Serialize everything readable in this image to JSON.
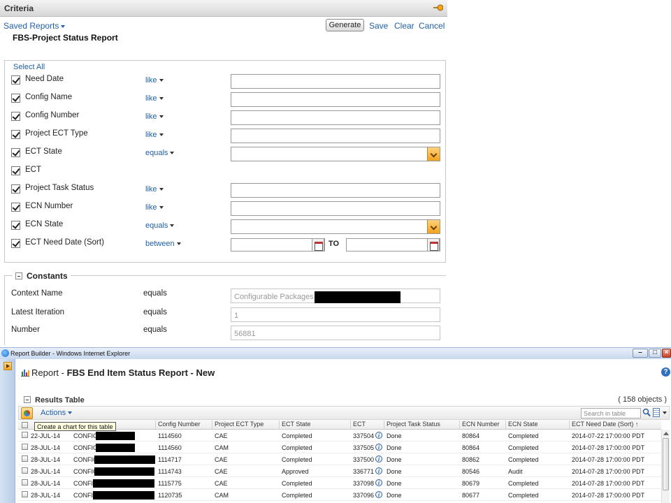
{
  "criteria_panel": {
    "header_title": "Criteria",
    "saved_reports": "Saved Reports",
    "buttons": {
      "generate": "Generate",
      "save": "Save",
      "clear": "Clear",
      "cancel": "Cancel"
    },
    "report_title": "FBS-Project Status Report",
    "select_all": "Select All",
    "rows": [
      {
        "label": "Need Date",
        "operator": "like"
      },
      {
        "label": "Config Name",
        "operator": "like"
      },
      {
        "label": "Config Number",
        "operator": "like"
      },
      {
        "label": "Project ECT Type",
        "operator": "like"
      },
      {
        "label": "ECT State",
        "operator": "equals"
      },
      {
        "label": "ECT",
        "operator": ""
      },
      {
        "label": "Project Task Status",
        "operator": "like"
      },
      {
        "label": "ECN Number",
        "operator": "like"
      },
      {
        "label": "ECN State",
        "operator": "equals"
      },
      {
        "label": "ECT Need Date (Sort)",
        "operator": "between"
      }
    ],
    "to_label": "TO"
  },
  "constants": {
    "title": "Constants",
    "rows": [
      {
        "label": "Context Name",
        "operator": "equals",
        "value": "Configurable Packages"
      },
      {
        "label": "Latest Iteration",
        "operator": "equals",
        "value": "1"
      },
      {
        "label": "Number",
        "operator": "equals",
        "value": "56881"
      }
    ]
  },
  "browser": {
    "window_title": "Report Builder - Windows Internet Explorer",
    "report_prefix": "Report - ",
    "report_name": "FBS End Item Status Report - New",
    "results_title": "Results Table",
    "results_count": "( 158 objects )",
    "actions_label": "Actions",
    "search_placeholder": "Search in table",
    "chart_tooltip": "Create a chart for this table",
    "columns": [
      "Config Number",
      "Project ECT Type",
      "ECT State",
      "ECT",
      "Project Task Status",
      "ECN Number",
      "ECN State",
      "ECT Need Date (Sort)"
    ],
    "sort_indicator": "↑",
    "rows": [
      {
        "need_date": "22-JUL-14",
        "config_name": "CONFIG,",
        "config_number": "1114560",
        "ect_type": "CAE",
        "ect_state": "Completed",
        "ect": "337504",
        "task_status": "Done",
        "ecn_number": "80864",
        "ecn_state": "Completed",
        "ect_need_date": "2014-07-22 17:00:00 PDT"
      },
      {
        "need_date": "28-JUL-14",
        "config_name": "CONFIG,",
        "config_number": "1114560",
        "ect_type": "CAM",
        "ect_state": "Completed",
        "ect": "337505",
        "task_status": "Done",
        "ecn_number": "80864",
        "ecn_state": "Completed",
        "ect_need_date": "2014-07-28 17:00:00 PDT"
      },
      {
        "need_date": "28-JUL-14",
        "config_name": "CONFIG,",
        "config_number": "1114717",
        "ect_type": "CAE",
        "ect_state": "Completed",
        "ect": "337500",
        "task_status": "Done",
        "ecn_number": "80862",
        "ecn_state": "Completed",
        "ect_need_date": "2014-07-28 17:00:00 PDT"
      },
      {
        "need_date": "28-JUL-14",
        "config_name": "CONFIG,",
        "config_number": "1114743",
        "ect_type": "CAE",
        "ect_state": "Approved",
        "ect": "336771",
        "task_status": "Done",
        "ecn_number": "80546",
        "ecn_state": "Audit",
        "ect_need_date": "2014-07-28 17:00:00 PDT"
      },
      {
        "need_date": "28-JUL-14",
        "config_name": "CONFIG",
        "config_number": "1115775",
        "ect_type": "CAE",
        "ect_state": "Completed",
        "ect": "337098",
        "task_status": "Done",
        "ecn_number": "80679",
        "ecn_state": "Completed",
        "ect_need_date": "2014-07-28 17:00:00 PDT"
      },
      {
        "need_date": "28-JUL-14",
        "config_name": "CONFIG",
        "config_number": "1120735",
        "ect_type": "CAM",
        "ect_state": "Completed",
        "ect": "337096",
        "task_status": "Done",
        "ecn_number": "80677",
        "ecn_state": "Completed",
        "ect_need_date": "2014-07-28 17:00:00 PDT"
      }
    ]
  },
  "colors": {
    "link": "#1f5fa6",
    "accent_orange": "#f2a21e",
    "titlebar": "#c8d8ee"
  }
}
